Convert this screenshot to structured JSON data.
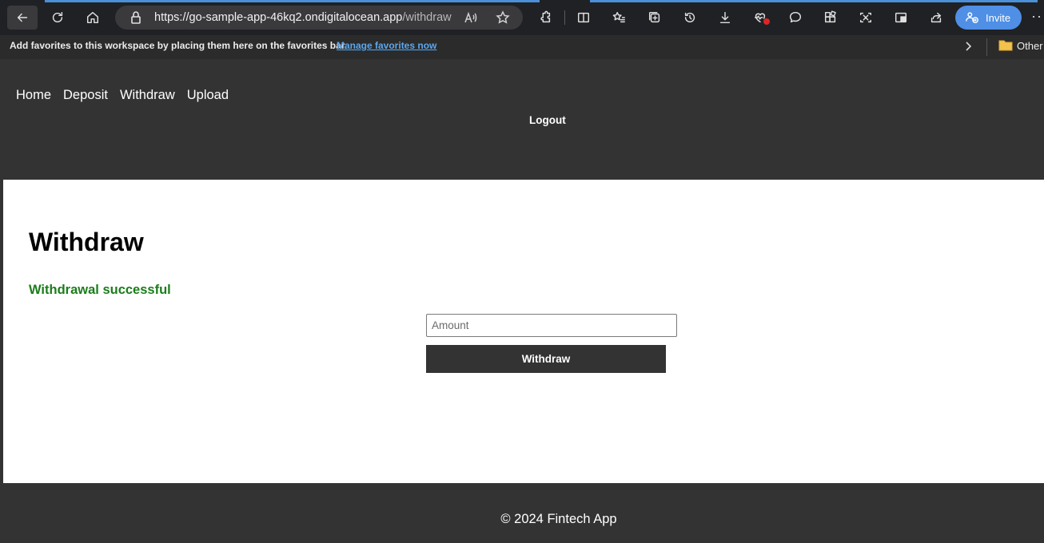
{
  "browser": {
    "url_host": "https://go-sample-app-46kq2.ondigitalocean.app",
    "url_path": "/withdraw",
    "invite_label": "Invite",
    "accent_color": "#4f8fe6"
  },
  "favorites_bar": {
    "message": "Add favorites to this workspace by placing them here on the favorites bar.",
    "manage_link": "Manage favorites now",
    "other_label": "Other"
  },
  "nav": {
    "items": [
      {
        "label": "Home"
      },
      {
        "label": "Deposit"
      },
      {
        "label": "Withdraw"
      },
      {
        "label": "Upload"
      }
    ],
    "logout_label": "Logout"
  },
  "main": {
    "title": "Withdraw",
    "status_message": "Withdrawal successful",
    "status_color": "#1a7d1a",
    "amount_placeholder": "Amount",
    "amount_value": "",
    "submit_label": "Withdraw"
  },
  "footer": {
    "text": "© 2024 Fintech App"
  }
}
